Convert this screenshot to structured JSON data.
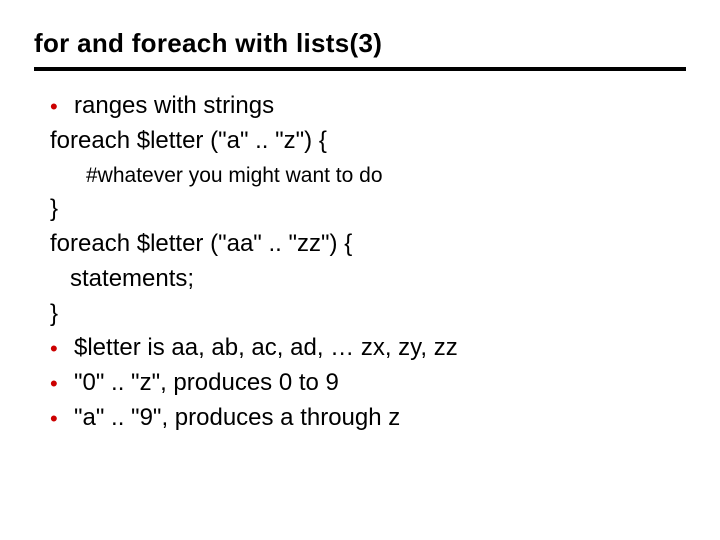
{
  "title": "for and foreach with lists(3)",
  "bullet1": "ranges with strings",
  "line_foreach1": "foreach $letter (\"a\" .. \"z\") {",
  "comment": "#whatever you might want to do",
  "line_close1": "}",
  "line_foreach2": "foreach $letter (\"aa\" .. \"zz\") {",
  "line_statements": "   statements;",
  "line_close2": "}",
  "bullet2": "$letter is aa, ab, ac, ad, … zx, zy, zz",
  "bullet3": "\"0\" .. \"z\", produces 0 to 9",
  "bullet4": "\"a\" .. \"9\", produces a through z"
}
